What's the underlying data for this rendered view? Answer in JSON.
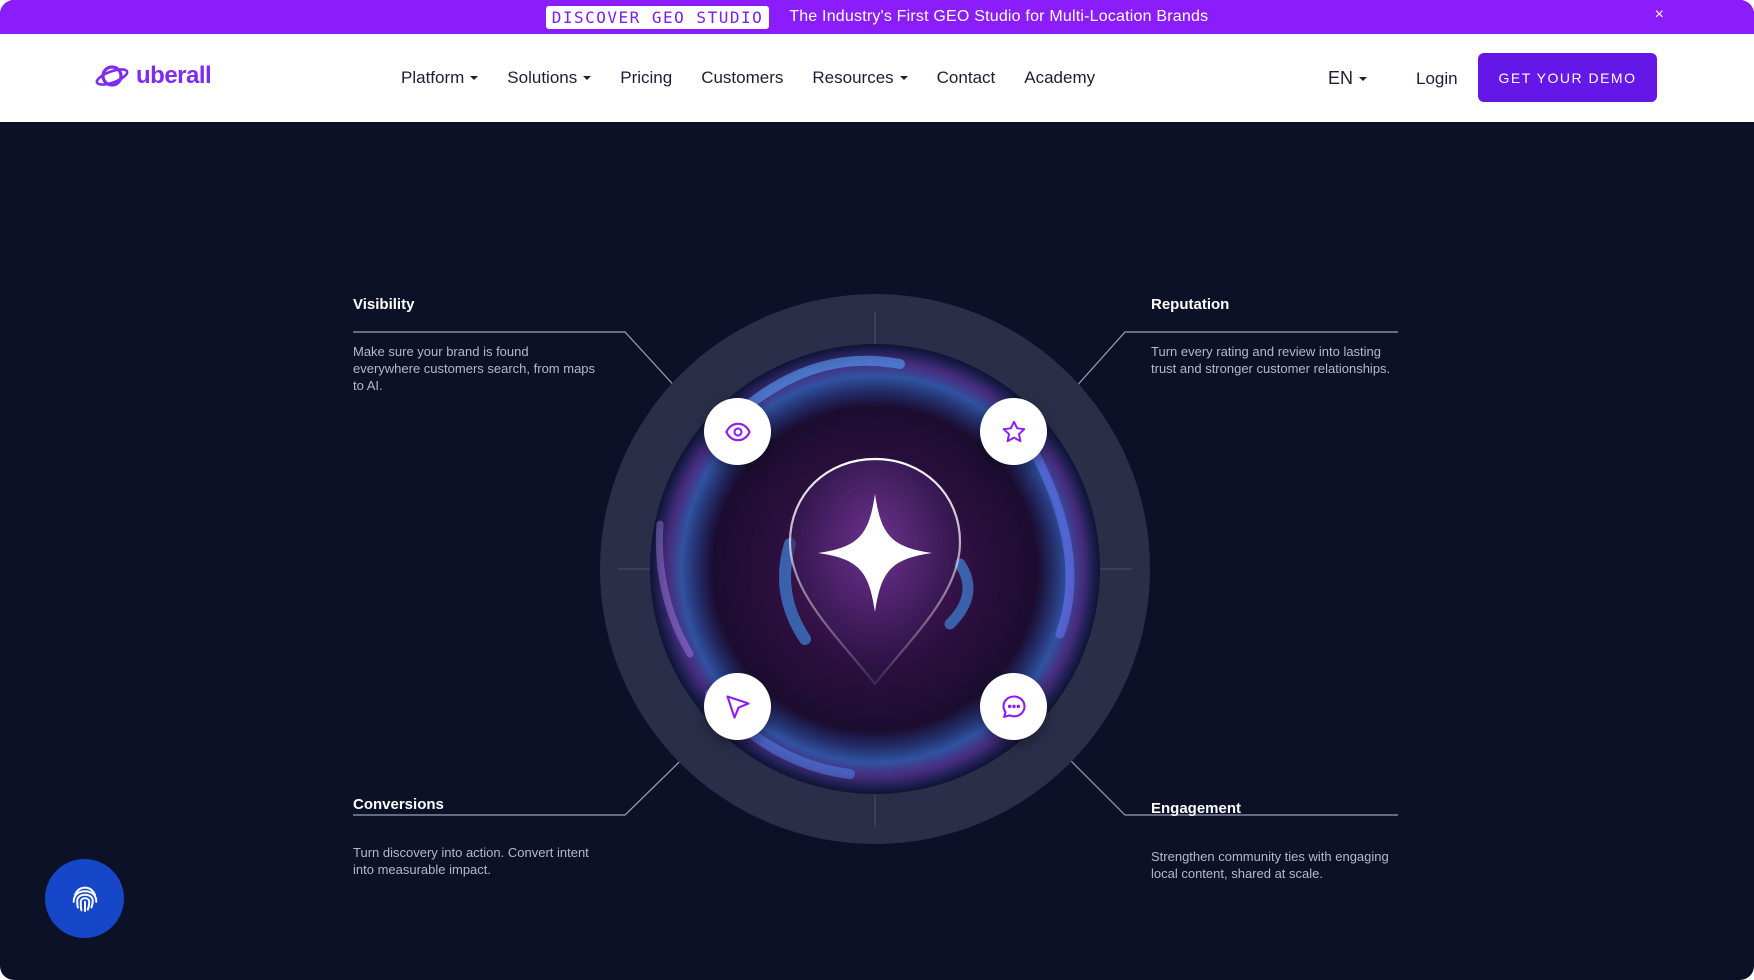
{
  "announcement": {
    "badge": "DISCOVER GEO STUDIO",
    "message": "The Industry's First GEO Studio for Multi-Location Brands",
    "close": "×"
  },
  "header": {
    "logo_text": "uberall",
    "nav": [
      {
        "label": "Platform",
        "dropdown": true
      },
      {
        "label": "Solutions",
        "dropdown": true
      },
      {
        "label": "Pricing",
        "dropdown": false
      },
      {
        "label": "Customers",
        "dropdown": false
      },
      {
        "label": "Resources",
        "dropdown": true
      },
      {
        "label": "Contact",
        "dropdown": false
      },
      {
        "label": "Academy",
        "dropdown": false
      }
    ],
    "language": "EN",
    "login": "Login",
    "cta": "GET YOUR DEMO"
  },
  "features": {
    "visibility": {
      "title": "Visibility",
      "description": "Make sure your brand is found everywhere customers search, from maps to AI.",
      "icon": "eye-icon"
    },
    "reputation": {
      "title": "Reputation",
      "description": "Turn every rating and review into lasting trust and stronger customer relationships.",
      "icon": "star-icon"
    },
    "conversions": {
      "title": "Conversions",
      "description": "Turn discovery into action. Convert intent into measurable impact.",
      "icon": "cursor-arrow-icon"
    },
    "engagement": {
      "title": "Engagement",
      "description": "Strengthen community ties with engaging local content, shared at scale.",
      "icon": "chat-bubble-icon"
    }
  },
  "colors": {
    "brand_purple": "#8b1dfb",
    "cta_purple": "#6417e6",
    "hero_background": "#0d1128",
    "fingerprint_blue": "#1547c8"
  },
  "floating_button": {
    "icon": "fingerprint-icon"
  }
}
